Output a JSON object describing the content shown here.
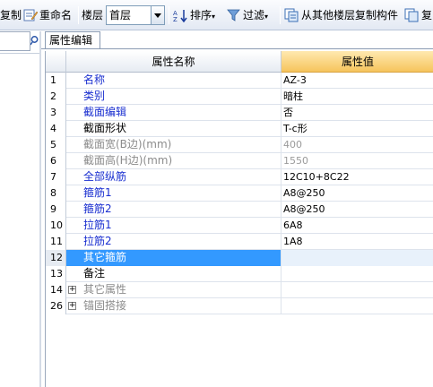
{
  "toolbar": {
    "copy_label": "复制",
    "rename_label": "重命名",
    "floor_label": "楼层",
    "floor_value": "首层",
    "sort_label": "排序",
    "filter_label": "过滤",
    "copy_from_floor_label": "从其他楼层复制构件",
    "copy2_label": "复"
  },
  "tab": {
    "label": "属性编辑"
  },
  "grid": {
    "header_name": "属性名称",
    "header_value": "属性值",
    "rows": [
      {
        "num": "1",
        "name": "名称",
        "value": "AZ-3"
      },
      {
        "num": "2",
        "name": "类别",
        "value": "暗柱"
      },
      {
        "num": "3",
        "name": "截面编辑",
        "value": "否"
      },
      {
        "num": "4",
        "name": "截面形状",
        "value": "T-c形"
      },
      {
        "num": "5",
        "name": "截面宽(B边)(mm)",
        "value": "400"
      },
      {
        "num": "6",
        "name": "截面高(H边)(mm)",
        "value": "1550"
      },
      {
        "num": "7",
        "name": "全部纵筋",
        "value": "12C10+8C22"
      },
      {
        "num": "8",
        "name": "箍筋1",
        "value": "A8@250"
      },
      {
        "num": "9",
        "name": "箍筋2",
        "value": "A8@250"
      },
      {
        "num": "10",
        "name": "拉筋1",
        "value": "6A8"
      },
      {
        "num": "11",
        "name": "拉筋2",
        "value": "1A8"
      },
      {
        "num": "12",
        "name": "其它箍筋",
        "value": ""
      },
      {
        "num": "13",
        "name": "备注",
        "value": ""
      },
      {
        "num": "14",
        "name": "其它属性",
        "value": ""
      },
      {
        "num": "26",
        "name": "锚固搭接",
        "value": ""
      }
    ]
  },
  "colors": {
    "accent_header": "#f6c45c",
    "selected_row": "#3399ff",
    "link_text": "#1a2fd0"
  }
}
